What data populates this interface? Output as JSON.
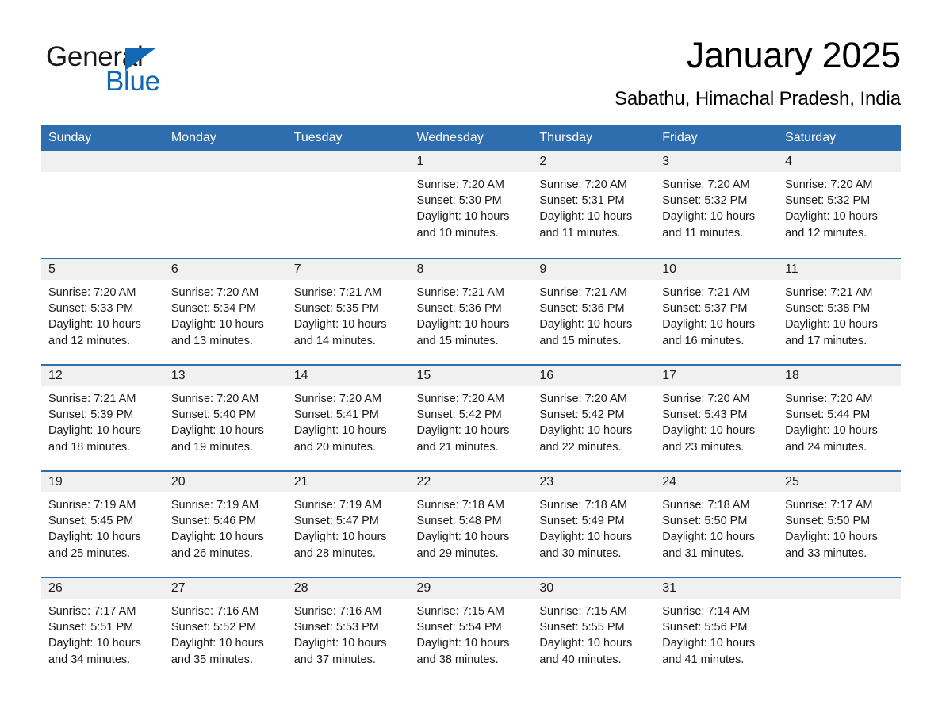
{
  "brand": {
    "name_part1": "General",
    "name_part2": "Blue",
    "accent_color": "#1268b3"
  },
  "header": {
    "month_title": "January 2025",
    "location": "Sabathu, Himachal Pradesh, India",
    "header_color": "#2E6DAE"
  },
  "calendar": {
    "weekday_headers": [
      "Sunday",
      "Monday",
      "Tuesday",
      "Wednesday",
      "Thursday",
      "Friday",
      "Saturday"
    ],
    "weeks": [
      [
        {
          "day": "",
          "sunrise": "",
          "sunset": "",
          "daylight_line1": "",
          "daylight_line2": ""
        },
        {
          "day": "",
          "sunrise": "",
          "sunset": "",
          "daylight_line1": "",
          "daylight_line2": ""
        },
        {
          "day": "",
          "sunrise": "",
          "sunset": "",
          "daylight_line1": "",
          "daylight_line2": ""
        },
        {
          "day": "1",
          "sunrise": "Sunrise: 7:20 AM",
          "sunset": "Sunset: 5:30 PM",
          "daylight_line1": "Daylight: 10 hours",
          "daylight_line2": "and 10 minutes."
        },
        {
          "day": "2",
          "sunrise": "Sunrise: 7:20 AM",
          "sunset": "Sunset: 5:31 PM",
          "daylight_line1": "Daylight: 10 hours",
          "daylight_line2": "and 11 minutes."
        },
        {
          "day": "3",
          "sunrise": "Sunrise: 7:20 AM",
          "sunset": "Sunset: 5:32 PM",
          "daylight_line1": "Daylight: 10 hours",
          "daylight_line2": "and 11 minutes."
        },
        {
          "day": "4",
          "sunrise": "Sunrise: 7:20 AM",
          "sunset": "Sunset: 5:32 PM",
          "daylight_line1": "Daylight: 10 hours",
          "daylight_line2": "and 12 minutes."
        }
      ],
      [
        {
          "day": "5",
          "sunrise": "Sunrise: 7:20 AM",
          "sunset": "Sunset: 5:33 PM",
          "daylight_line1": "Daylight: 10 hours",
          "daylight_line2": "and 12 minutes."
        },
        {
          "day": "6",
          "sunrise": "Sunrise: 7:20 AM",
          "sunset": "Sunset: 5:34 PM",
          "daylight_line1": "Daylight: 10 hours",
          "daylight_line2": "and 13 minutes."
        },
        {
          "day": "7",
          "sunrise": "Sunrise: 7:21 AM",
          "sunset": "Sunset: 5:35 PM",
          "daylight_line1": "Daylight: 10 hours",
          "daylight_line2": "and 14 minutes."
        },
        {
          "day": "8",
          "sunrise": "Sunrise: 7:21 AM",
          "sunset": "Sunset: 5:36 PM",
          "daylight_line1": "Daylight: 10 hours",
          "daylight_line2": "and 15 minutes."
        },
        {
          "day": "9",
          "sunrise": "Sunrise: 7:21 AM",
          "sunset": "Sunset: 5:36 PM",
          "daylight_line1": "Daylight: 10 hours",
          "daylight_line2": "and 15 minutes."
        },
        {
          "day": "10",
          "sunrise": "Sunrise: 7:21 AM",
          "sunset": "Sunset: 5:37 PM",
          "daylight_line1": "Daylight: 10 hours",
          "daylight_line2": "and 16 minutes."
        },
        {
          "day": "11",
          "sunrise": "Sunrise: 7:21 AM",
          "sunset": "Sunset: 5:38 PM",
          "daylight_line1": "Daylight: 10 hours",
          "daylight_line2": "and 17 minutes."
        }
      ],
      [
        {
          "day": "12",
          "sunrise": "Sunrise: 7:21 AM",
          "sunset": "Sunset: 5:39 PM",
          "daylight_line1": "Daylight: 10 hours",
          "daylight_line2": "and 18 minutes."
        },
        {
          "day": "13",
          "sunrise": "Sunrise: 7:20 AM",
          "sunset": "Sunset: 5:40 PM",
          "daylight_line1": "Daylight: 10 hours",
          "daylight_line2": "and 19 minutes."
        },
        {
          "day": "14",
          "sunrise": "Sunrise: 7:20 AM",
          "sunset": "Sunset: 5:41 PM",
          "daylight_line1": "Daylight: 10 hours",
          "daylight_line2": "and 20 minutes."
        },
        {
          "day": "15",
          "sunrise": "Sunrise: 7:20 AM",
          "sunset": "Sunset: 5:42 PM",
          "daylight_line1": "Daylight: 10 hours",
          "daylight_line2": "and 21 minutes."
        },
        {
          "day": "16",
          "sunrise": "Sunrise: 7:20 AM",
          "sunset": "Sunset: 5:42 PM",
          "daylight_line1": "Daylight: 10 hours",
          "daylight_line2": "and 22 minutes."
        },
        {
          "day": "17",
          "sunrise": "Sunrise: 7:20 AM",
          "sunset": "Sunset: 5:43 PM",
          "daylight_line1": "Daylight: 10 hours",
          "daylight_line2": "and 23 minutes."
        },
        {
          "day": "18",
          "sunrise": "Sunrise: 7:20 AM",
          "sunset": "Sunset: 5:44 PM",
          "daylight_line1": "Daylight: 10 hours",
          "daylight_line2": "and 24 minutes."
        }
      ],
      [
        {
          "day": "19",
          "sunrise": "Sunrise: 7:19 AM",
          "sunset": "Sunset: 5:45 PM",
          "daylight_line1": "Daylight: 10 hours",
          "daylight_line2": "and 25 minutes."
        },
        {
          "day": "20",
          "sunrise": "Sunrise: 7:19 AM",
          "sunset": "Sunset: 5:46 PM",
          "daylight_line1": "Daylight: 10 hours",
          "daylight_line2": "and 26 minutes."
        },
        {
          "day": "21",
          "sunrise": "Sunrise: 7:19 AM",
          "sunset": "Sunset: 5:47 PM",
          "daylight_line1": "Daylight: 10 hours",
          "daylight_line2": "and 28 minutes."
        },
        {
          "day": "22",
          "sunrise": "Sunrise: 7:18 AM",
          "sunset": "Sunset: 5:48 PM",
          "daylight_line1": "Daylight: 10 hours",
          "daylight_line2": "and 29 minutes."
        },
        {
          "day": "23",
          "sunrise": "Sunrise: 7:18 AM",
          "sunset": "Sunset: 5:49 PM",
          "daylight_line1": "Daylight: 10 hours",
          "daylight_line2": "and 30 minutes."
        },
        {
          "day": "24",
          "sunrise": "Sunrise: 7:18 AM",
          "sunset": "Sunset: 5:50 PM",
          "daylight_line1": "Daylight: 10 hours",
          "daylight_line2": "and 31 minutes."
        },
        {
          "day": "25",
          "sunrise": "Sunrise: 7:17 AM",
          "sunset": "Sunset: 5:50 PM",
          "daylight_line1": "Daylight: 10 hours",
          "daylight_line2": "and 33 minutes."
        }
      ],
      [
        {
          "day": "26",
          "sunrise": "Sunrise: 7:17 AM",
          "sunset": "Sunset: 5:51 PM",
          "daylight_line1": "Daylight: 10 hours",
          "daylight_line2": "and 34 minutes."
        },
        {
          "day": "27",
          "sunrise": "Sunrise: 7:16 AM",
          "sunset": "Sunset: 5:52 PM",
          "daylight_line1": "Daylight: 10 hours",
          "daylight_line2": "and 35 minutes."
        },
        {
          "day": "28",
          "sunrise": "Sunrise: 7:16 AM",
          "sunset": "Sunset: 5:53 PM",
          "daylight_line1": "Daylight: 10 hours",
          "daylight_line2": "and 37 minutes."
        },
        {
          "day": "29",
          "sunrise": "Sunrise: 7:15 AM",
          "sunset": "Sunset: 5:54 PM",
          "daylight_line1": "Daylight: 10 hours",
          "daylight_line2": "and 38 minutes."
        },
        {
          "day": "30",
          "sunrise": "Sunrise: 7:15 AM",
          "sunset": "Sunset: 5:55 PM",
          "daylight_line1": "Daylight: 10 hours",
          "daylight_line2": "and 40 minutes."
        },
        {
          "day": "31",
          "sunrise": "Sunrise: 7:14 AM",
          "sunset": "Sunset: 5:56 PM",
          "daylight_line1": "Daylight: 10 hours",
          "daylight_line2": "and 41 minutes."
        },
        {
          "day": "",
          "sunrise": "",
          "sunset": "",
          "daylight_line1": "",
          "daylight_line2": ""
        }
      ]
    ]
  }
}
